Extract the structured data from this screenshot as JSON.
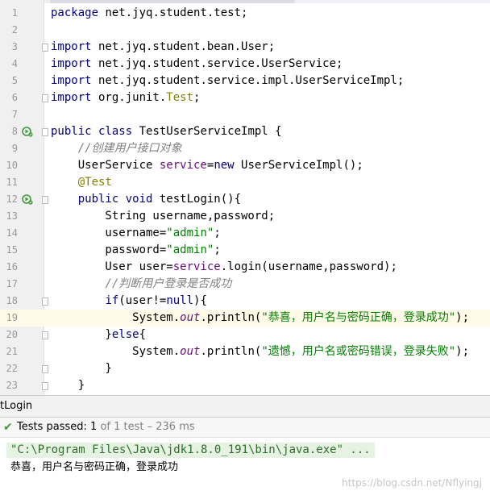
{
  "editor": {
    "line_numbers": [
      "1",
      "2",
      "3",
      "4",
      "5",
      "6",
      "7",
      "8",
      "9",
      "10",
      "11",
      "12",
      "13",
      "14",
      "15",
      "16",
      "17",
      "18",
      "19",
      "20",
      "21",
      "22",
      "23"
    ],
    "lines": [
      {
        "segments": [
          {
            "t": "package",
            "c": "kw"
          },
          {
            "t": " net.jyq.student.test;",
            "c": ""
          }
        ]
      },
      {
        "segments": []
      },
      {
        "segments": [
          {
            "t": "import",
            "c": "kw"
          },
          {
            "t": " net.jyq.student.bean.User;",
            "c": ""
          }
        ]
      },
      {
        "segments": [
          {
            "t": "import",
            "c": "kw"
          },
          {
            "t": " net.jyq.student.service.UserService;",
            "c": ""
          }
        ]
      },
      {
        "segments": [
          {
            "t": "import",
            "c": "kw"
          },
          {
            "t": " net.jyq.student.service.impl.UserServiceImpl;",
            "c": ""
          }
        ]
      },
      {
        "segments": [
          {
            "t": "import",
            "c": "kw"
          },
          {
            "t": " org.junit.",
            "c": ""
          },
          {
            "t": "Test",
            "c": "cls"
          },
          {
            "t": ";",
            "c": ""
          }
        ]
      },
      {
        "segments": []
      },
      {
        "segments": [
          {
            "t": "public class",
            "c": "kw"
          },
          {
            "t": " TestUserServiceImpl {",
            "c": ""
          }
        ]
      },
      {
        "segments": [
          {
            "t": "    ",
            "c": ""
          },
          {
            "t": "//创建用户接口对象",
            "c": "cmt"
          }
        ]
      },
      {
        "segments": [
          {
            "t": "    UserService ",
            "c": ""
          },
          {
            "t": "service",
            "c": "fld"
          },
          {
            "t": "=",
            "c": ""
          },
          {
            "t": "new",
            "c": "kw"
          },
          {
            "t": " UserServiceImpl();",
            "c": ""
          }
        ]
      },
      {
        "segments": [
          {
            "t": "    ",
            "c": ""
          },
          {
            "t": "@Test",
            "c": "ann"
          }
        ]
      },
      {
        "segments": [
          {
            "t": "    ",
            "c": ""
          },
          {
            "t": "public void",
            "c": "kw"
          },
          {
            "t": " testLogin(){",
            "c": ""
          }
        ]
      },
      {
        "segments": [
          {
            "t": "        String username,password;",
            "c": ""
          }
        ]
      },
      {
        "segments": [
          {
            "t": "        username=",
            "c": ""
          },
          {
            "t": "\"admin\"",
            "c": "str"
          },
          {
            "t": ";",
            "c": ""
          }
        ]
      },
      {
        "segments": [
          {
            "t": "        password=",
            "c": ""
          },
          {
            "t": "\"admin\"",
            "c": "str"
          },
          {
            "t": ";",
            "c": ""
          }
        ]
      },
      {
        "segments": [
          {
            "t": "        User user=",
            "c": ""
          },
          {
            "t": "service",
            "c": "fld"
          },
          {
            "t": ".login(username,password);",
            "c": ""
          }
        ]
      },
      {
        "segments": [
          {
            "t": "        ",
            "c": ""
          },
          {
            "t": "//判断用户登录是否成功",
            "c": "cmt"
          }
        ]
      },
      {
        "segments": [
          {
            "t": "        ",
            "c": ""
          },
          {
            "t": "if",
            "c": "kw"
          },
          {
            "t": "(user!=",
            "c": ""
          },
          {
            "t": "null",
            "c": "kw"
          },
          {
            "t": "){",
            "c": ""
          }
        ]
      },
      {
        "segments": [
          {
            "t": "            System.",
            "c": ""
          },
          {
            "t": "out",
            "c": "sf"
          },
          {
            "t": ".println(",
            "c": ""
          },
          {
            "t": "\"恭喜，用户名与密码正确，登录成功\"",
            "c": "str"
          },
          {
            "t": ");",
            "c": ""
          }
        ]
      },
      {
        "segments": [
          {
            "t": "        }",
            "c": ""
          },
          {
            "t": "else",
            "c": "kw"
          },
          {
            "t": "{",
            "c": ""
          }
        ]
      },
      {
        "segments": [
          {
            "t": "            System.",
            "c": ""
          },
          {
            "t": "out",
            "c": "sf"
          },
          {
            "t": ".println(",
            "c": ""
          },
          {
            "t": "\"遗憾，用户名或密码错误，登录失败\"",
            "c": "str"
          },
          {
            "t": ");",
            "c": ""
          }
        ]
      },
      {
        "segments": [
          {
            "t": "        }",
            "c": ""
          }
        ]
      },
      {
        "segments": [
          {
            "t": "    }",
            "c": ""
          }
        ]
      }
    ],
    "current_line": 19,
    "colors": {
      "keyword": "#000080",
      "string": "#008000",
      "field": "#660e7a",
      "comment": "#808080",
      "annotation": "#808000",
      "current_line_bg": "#fffbe8"
    }
  },
  "run_panel": {
    "tab_label": "tLogin",
    "status_icon": "check-icon",
    "status_passed": "Tests passed:",
    "status_count": "1",
    "status_detail": "of 1 test – 236 ms",
    "console_command": "\"C:\\Program Files\\Java\\jdk1.8.0_191\\bin\\java.exe\" ...",
    "console_output": "恭喜，用户名与密码正确，登录成功"
  },
  "watermark": "https://blog.csdn.net/Nflyingj"
}
